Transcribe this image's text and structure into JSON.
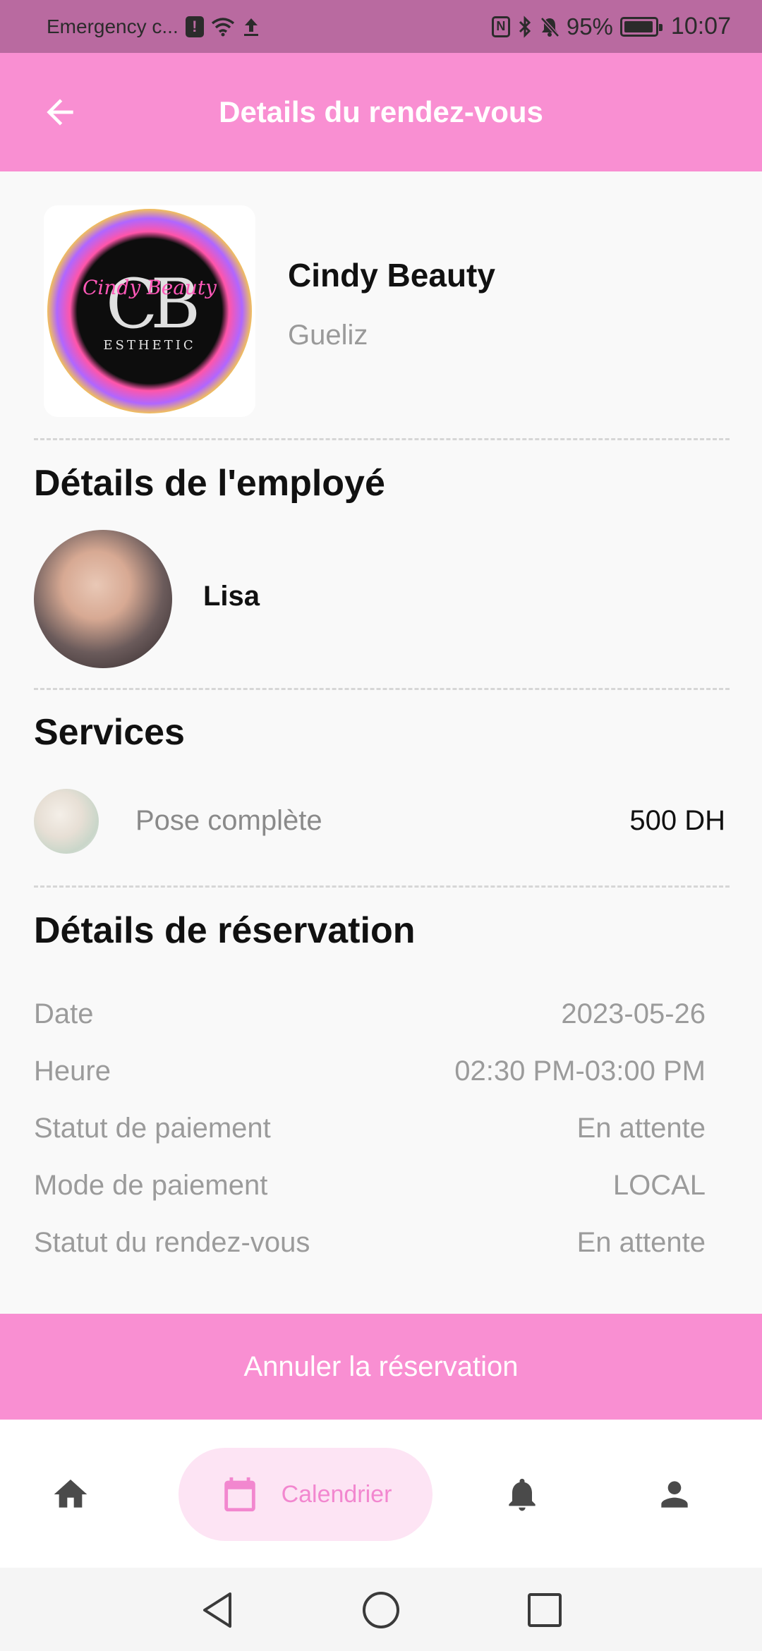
{
  "status_bar": {
    "carrier": "Emergency c...",
    "battery": "95%",
    "battery_level": 0.95,
    "time": "10:07",
    "icons": [
      "alert-badge-icon",
      "wifi-icon",
      "upload-icon",
      "nfc-icon",
      "bluetooth-icon",
      "silent-bell-icon",
      "battery-charging-icon"
    ]
  },
  "header": {
    "title": "Details du rendez-vous",
    "back_icon": "arrow-left-icon"
  },
  "salon": {
    "name": "Cindy Beauty",
    "location": "Gueliz",
    "logo_text": "CB",
    "logo_script": "Cindy Beauty",
    "logo_sub": "ESTHETIC"
  },
  "employee": {
    "section_title": "Détails de l'employé",
    "name": "Lisa"
  },
  "services": {
    "section_title": "Services",
    "items": [
      {
        "name": "Pose complète",
        "price": "500 DH"
      }
    ]
  },
  "reservation": {
    "section_title": "Détails de réservation",
    "rows": [
      {
        "label": "Date",
        "value": "2023-05-26"
      },
      {
        "label": "Heure",
        "value": "02:30 PM-03:00 PM"
      },
      {
        "label": "Statut de paiement",
        "value": "En attente"
      },
      {
        "label": "Mode de paiement",
        "value": "LOCAL"
      },
      {
        "label": "Statut du rendez-vous",
        "value": "En attente"
      }
    ]
  },
  "actions": {
    "cancel_label": "Annuler la réservation"
  },
  "bottom_nav": {
    "items": [
      {
        "icon": "home-icon",
        "label": ""
      },
      {
        "icon": "calendar-icon",
        "label": "Calendrier",
        "active": true
      },
      {
        "icon": "bell-icon",
        "label": ""
      },
      {
        "icon": "person-icon",
        "label": ""
      }
    ]
  },
  "colors": {
    "primary": "#f98fd2",
    "status_bar": "#b96aa0",
    "active_pill": "#fde4f4",
    "active_text": "#f287cf"
  }
}
